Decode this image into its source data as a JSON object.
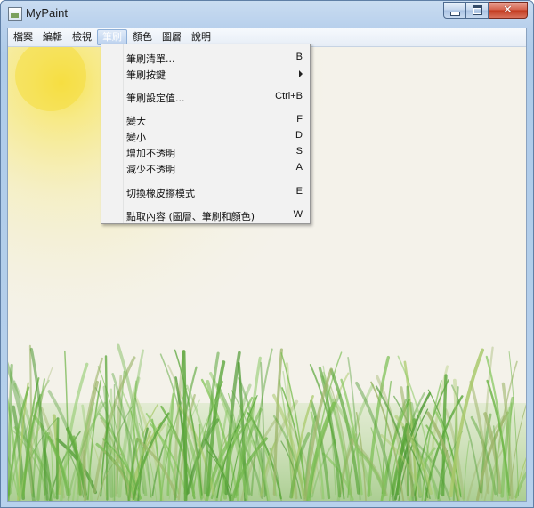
{
  "window": {
    "title": "MyPaint"
  },
  "menubar": {
    "items": [
      {
        "label": "檔案"
      },
      {
        "label": "編輯"
      },
      {
        "label": "檢視"
      },
      {
        "label": "筆刷"
      },
      {
        "label": "顏色"
      },
      {
        "label": "圖層"
      },
      {
        "label": "說明"
      }
    ],
    "active_index": 3
  },
  "brush_menu": {
    "items": [
      {
        "label": "筆刷清單...",
        "shortcut": "B"
      },
      {
        "label": "筆刷按鍵",
        "shortcut": "",
        "submenu": true
      },
      {
        "label": "筆刷設定值...",
        "shortcut": "Ctrl+B"
      },
      {
        "label": "變大",
        "shortcut": "F"
      },
      {
        "label": "變小",
        "shortcut": "D"
      },
      {
        "label": "增加不透明",
        "shortcut": "S"
      },
      {
        "label": "減少不透明",
        "shortcut": "A"
      },
      {
        "label": "切換橡皮擦模式",
        "shortcut": "E"
      },
      {
        "label": "點取內容 (圖層、筆刷和顏色)",
        "shortcut": "W"
      }
    ]
  },
  "colors": {
    "sun": "#f7e46a",
    "grass": "#6fb04a",
    "canvas_bg": "#f4f2ea"
  },
  "icons": {
    "app": "mypaint-app-icon",
    "minimize": "minimize-icon",
    "maximize": "maximize-icon",
    "close": "close-icon",
    "submenu": "submenu-arrow-icon"
  }
}
